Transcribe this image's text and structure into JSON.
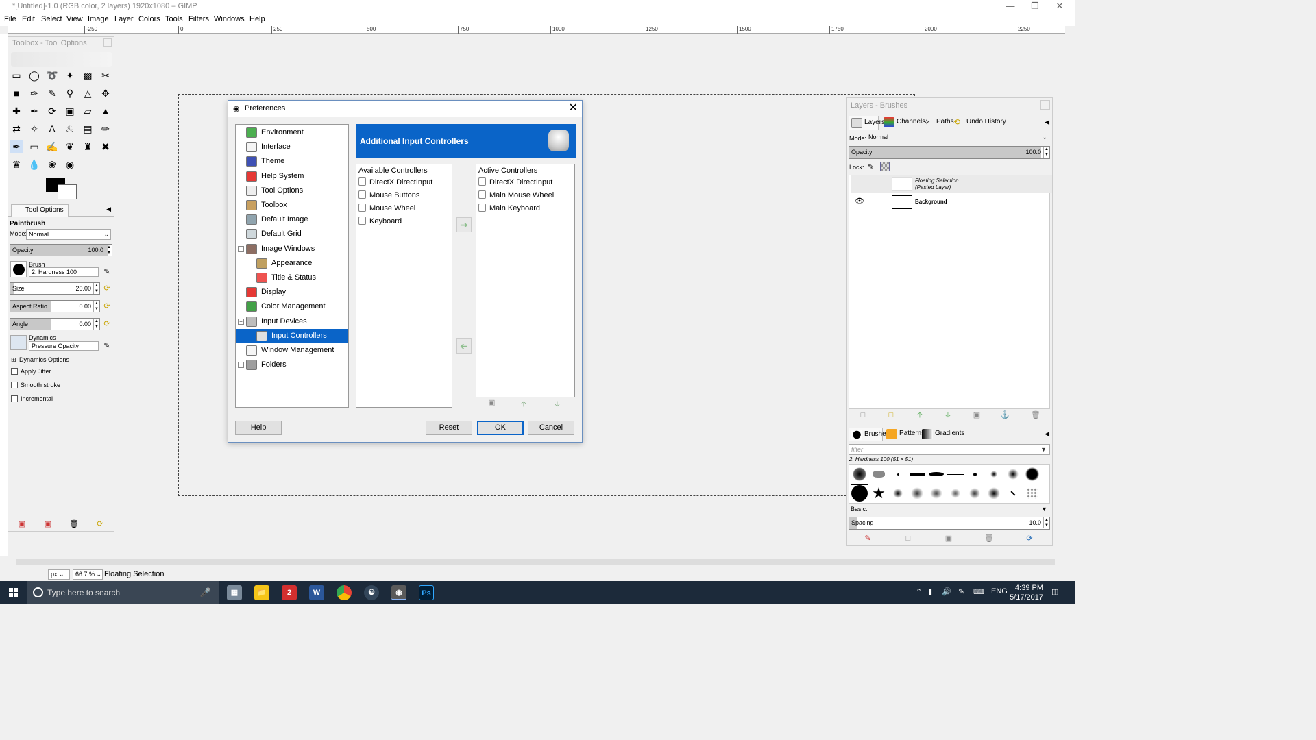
{
  "window": {
    "title": "*[Untitled]-1.0 (RGB color, 2 layers) 1920x1080 – GIMP",
    "minimize_icon": "minimize-icon",
    "maximize_icon": "maximize-icon",
    "close_icon": "close-icon"
  },
  "menubar": [
    "File",
    "Edit",
    "Select",
    "View",
    "Image",
    "Layer",
    "Colors",
    "Tools",
    "Filters",
    "Windows",
    "Help"
  ],
  "ruler": {
    "ticks": [
      "-250",
      "0",
      "250",
      "500",
      "750",
      "1000",
      "1250",
      "1500",
      "1750",
      "2000",
      "2250"
    ]
  },
  "toolbox": {
    "title": "Toolbox - Tool Options",
    "tab_label": "Tool Options",
    "tool_name": "Paintbrush",
    "mode_label": "Mode:",
    "mode_value": "Normal",
    "opacity_label": "Opacity",
    "opacity_value": "100.0",
    "opacity_fraction": 1.0,
    "brush_label": "Brush",
    "brush_value": "2. Hardness 100",
    "size_label": "Size",
    "size_value": "20.00",
    "aspect_label": "Aspect Ratio",
    "aspect_value": "0.00",
    "angle_label": "Angle",
    "angle_value": "0.00",
    "dynamics_label": "Dynamics",
    "dynamics_value": "Pressure Opacity",
    "dynamics_options": "Dynamics Options",
    "apply_jitter": "Apply Jitter",
    "smooth_stroke": "Smooth stroke",
    "incremental": "Incremental"
  },
  "preferences": {
    "title": "Preferences",
    "tree": [
      {
        "label": "Environment",
        "icon": "environment-icon",
        "color": "#4caf50"
      },
      {
        "label": "Interface",
        "icon": "interface-icon",
        "color": "#f5f5f5"
      },
      {
        "label": "Theme",
        "icon": "theme-icon",
        "color": "#3f51b5"
      },
      {
        "label": "Help System",
        "icon": "help-system-icon",
        "color": "#e53935"
      },
      {
        "label": "Tool Options",
        "icon": "tool-options-icon",
        "color": "#eeeeee"
      },
      {
        "label": "Toolbox",
        "icon": "toolbox-icon",
        "color": "#c8a060"
      },
      {
        "label": "Default Image",
        "icon": "default-image-icon",
        "color": "#90a4ae"
      },
      {
        "label": "Default Grid",
        "icon": "default-grid-icon",
        "color": "#cfd8dc"
      },
      {
        "label": "Image Windows",
        "icon": "image-windows-icon",
        "color": "#8d6e63"
      },
      {
        "label": "Appearance",
        "icon": "appearance-icon",
        "color": "#c0a060"
      },
      {
        "label": "Title & Status",
        "icon": "title-status-icon",
        "color": "#ef5350"
      },
      {
        "label": "Display",
        "icon": "display-icon",
        "color": "#e53935"
      },
      {
        "label": "Color Management",
        "icon": "color-management-icon",
        "color": "#43a047"
      },
      {
        "label": "Input Devices",
        "icon": "input-devices-icon",
        "color": "#bdbdbd"
      },
      {
        "label": "Input Controllers",
        "icon": "input-controllers-icon",
        "color": "#e0e0e0"
      },
      {
        "label": "Window Management",
        "icon": "window-management-icon",
        "color": "#f5f5f5"
      },
      {
        "label": "Folders",
        "icon": "folders-icon",
        "color": "#9e9e9e"
      }
    ],
    "banner_title": "Additional Input Controllers",
    "available_header": "Available Controllers",
    "available": [
      "DirectX DirectInput",
      "Mouse Buttons",
      "Mouse Wheel",
      "Keyboard"
    ],
    "active_header": "Active Controllers",
    "active": [
      "DirectX DirectInput",
      "Main Mouse Wheel",
      "Main Keyboard"
    ],
    "buttons": {
      "help": "Help",
      "reset": "Reset",
      "ok": "OK",
      "cancel": "Cancel"
    },
    "accent": "#0a64c8"
  },
  "dock": {
    "title": "Layers - Brushes",
    "tabs": [
      "Layers",
      "Channels",
      "Paths",
      "Undo History"
    ],
    "mode_label": "Mode:",
    "mode_value": "Normal",
    "opacity_label": "Opacity",
    "opacity_value": "100.0",
    "lock_label": "Lock:",
    "layers": [
      {
        "name": "Floating Selection",
        "sub": "(Pasted Layer)"
      },
      {
        "name": "Background",
        "sub": ""
      }
    ],
    "brush_tabs": [
      "Brushes",
      "Patterns",
      "Gradients"
    ],
    "filter_placeholder": "filter",
    "brush_info": "2. Hardness 100 (51 × 51)",
    "brush_set": "Basic.",
    "spacing_label": "Spacing",
    "spacing_value": "10.0"
  },
  "statusbar": {
    "unit": "px",
    "zoom": "66.7 %",
    "message": "Floating Selection"
  },
  "taskbar": {
    "search_placeholder": "Type here to search",
    "time": "4:39 PM",
    "date": "5/17/2017",
    "lang": "ENG"
  }
}
